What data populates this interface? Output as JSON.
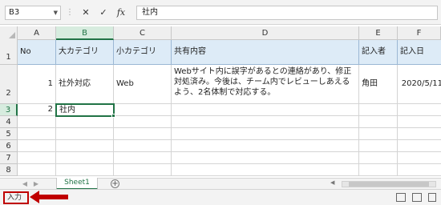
{
  "formula_bar": {
    "name_box": "B3",
    "cancel_icon": "✕",
    "enter_icon": "✓",
    "fx_label": "fx",
    "content": "社内"
  },
  "columns": [
    "A",
    "B",
    "C",
    "D",
    "E",
    "F"
  ],
  "rows": [
    "1",
    "2",
    "3",
    "4",
    "5",
    "6",
    "7",
    "8"
  ],
  "table": {
    "headers": [
      "No",
      "大カテゴリ",
      "小カテゴリ",
      "共有内容",
      "記入者",
      "記入日"
    ],
    "row2": {
      "no": "1",
      "major": "社外対応",
      "minor": "Web",
      "content": "Webサイト内に誤字があるとの連絡があり、修正対処済み。今後は、チーム内でレビューしあえるよう、2名体制で対応する。",
      "author": "角田",
      "date": "2020/5/11"
    },
    "row3": {
      "no": "2",
      "major": "社内"
    }
  },
  "sheet_tabs": {
    "active": "Sheet1",
    "add_icon": "+"
  },
  "status_bar": {
    "mode": "入力"
  },
  "colors": {
    "accent": "#217346",
    "header_fill": "#ddebf7",
    "highlight_red": "#c00000"
  }
}
